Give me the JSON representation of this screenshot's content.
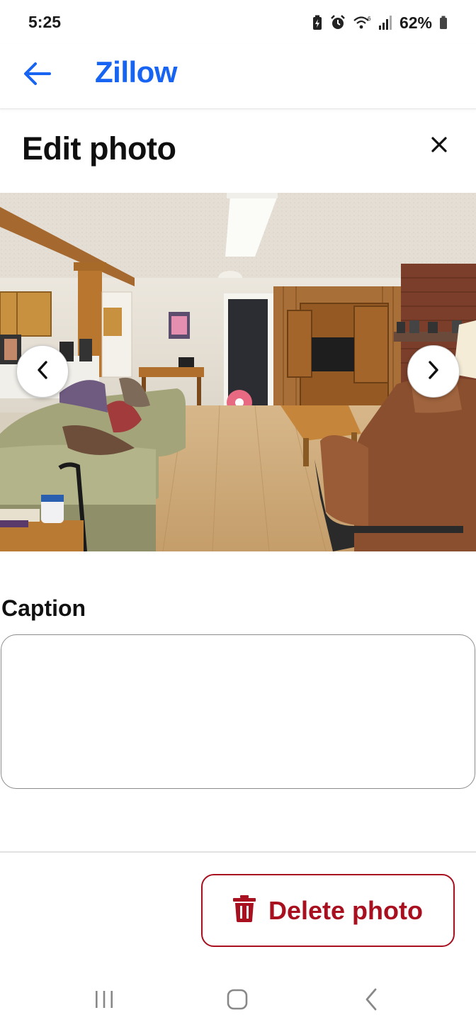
{
  "status_bar": {
    "time": "5:25",
    "battery_percent": "62%",
    "icons": [
      "battery-saver-icon",
      "alarm-icon",
      "wifi-icon",
      "signal-icon",
      "battery-icon"
    ]
  },
  "header": {
    "app_title": "Zillow",
    "back_icon": "arrow-left-icon"
  },
  "dialog": {
    "title": "Edit photo",
    "close_icon": "close-icon"
  },
  "photo": {
    "prev_icon": "chevron-left-icon",
    "next_icon": "chevron-right-icon"
  },
  "caption": {
    "label": "Caption",
    "value": "",
    "placeholder": ""
  },
  "footer": {
    "delete_label": "Delete photo",
    "delete_icon": "trash-icon"
  },
  "nav_bar": {
    "icons": [
      "recent-apps-icon",
      "home-icon",
      "back-nav-icon"
    ]
  },
  "colors": {
    "brand_blue": "#1763f2",
    "danger_red": "#a8101f",
    "text": "#111111"
  }
}
